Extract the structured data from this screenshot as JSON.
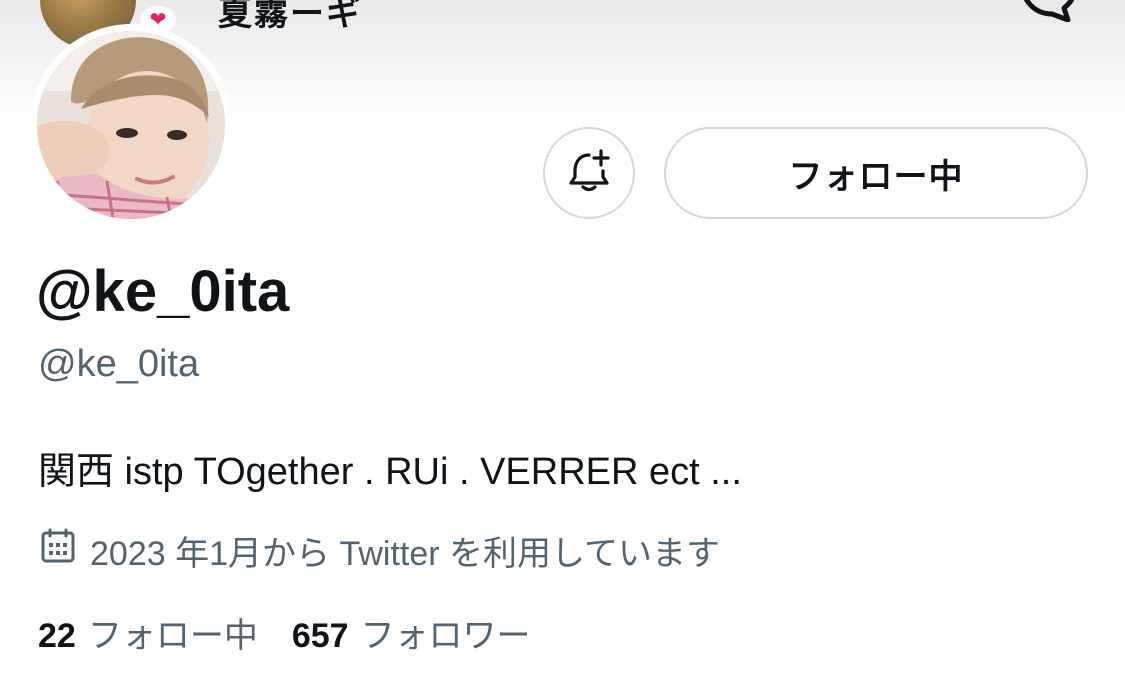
{
  "header": {
    "mini_name": "夏霧ーギ",
    "heart_glyph": "❤"
  },
  "profile": {
    "display_name": "@ke_0ita",
    "handle": "@ke_0ita",
    "bio": "関西 istp TOgether . RUi . VERRER ect ...",
    "joined": "2023 年1月から Twitter を利用しています"
  },
  "actions": {
    "follow_label": "フォロー中",
    "notify_icon": "bell-plus-icon"
  },
  "stats": {
    "following_count": "22",
    "following_label": "フォロー中",
    "followers_count": "657",
    "followers_label": "フォロワー"
  },
  "colors": {
    "text_primary": "#0f1419",
    "text_secondary": "#536471",
    "border": "#cfd9de"
  }
}
